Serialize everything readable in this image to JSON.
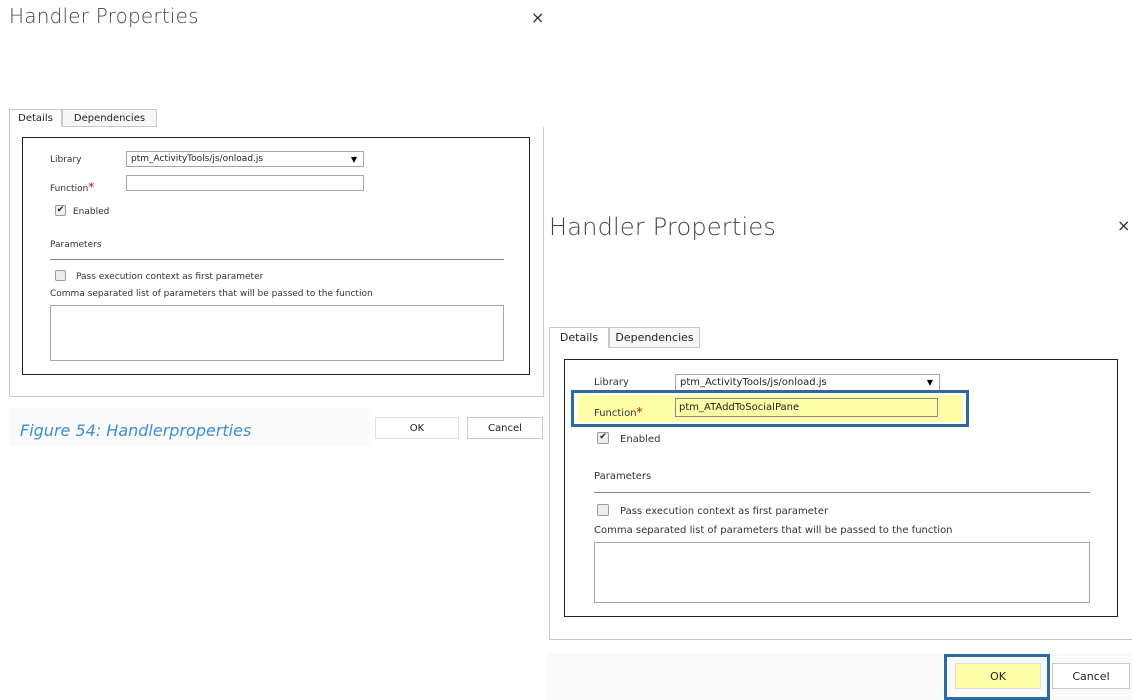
{
  "dialog1": {
    "title": "Handler Properties",
    "close": "×",
    "tabs": [
      {
        "label": "Details"
      },
      {
        "label": "Dependencies"
      }
    ],
    "library_label": "Library",
    "library_value": "ptm_ActivityTools/js/onload.js",
    "function_label": "Function",
    "required_mark": "*",
    "function_value": "",
    "enabled_label": "Enabled",
    "enabled_checked": true,
    "parameters_heading": "Parameters",
    "pass_context_label": "Pass execution context as first parameter",
    "params_desc": "Comma separated list of parameters that will be passed to the function",
    "ok_label": "OK",
    "cancel_label": "Cancel"
  },
  "caption": "Figure 54: Handlerproperties",
  "dialog2": {
    "title": "Handler Properties",
    "close": "×",
    "tabs": [
      {
        "label": "Details"
      },
      {
        "label": "Dependencies"
      }
    ],
    "library_label": "Library",
    "library_value": "ptm_ActivityTools/js/onload.js",
    "function_label": "Function",
    "required_mark": "*",
    "function_value": "ptm_ATAddToSocialPane",
    "enabled_label": "Enabled",
    "enabled_checked": true,
    "parameters_heading": "Parameters",
    "pass_context_label": "Pass execution context as first parameter",
    "params_desc": "Comma separated list of parameters that will be passed to the function",
    "ok_label": "OK",
    "cancel_label": "Cancel"
  },
  "icons": {
    "dropdown": "▼",
    "check": "✔"
  },
  "colors": {
    "highlight_fill": "#ffffa8",
    "highlight_border": "#2d6b9f",
    "caption": "#3d8fd0",
    "required": "#d9001b"
  }
}
